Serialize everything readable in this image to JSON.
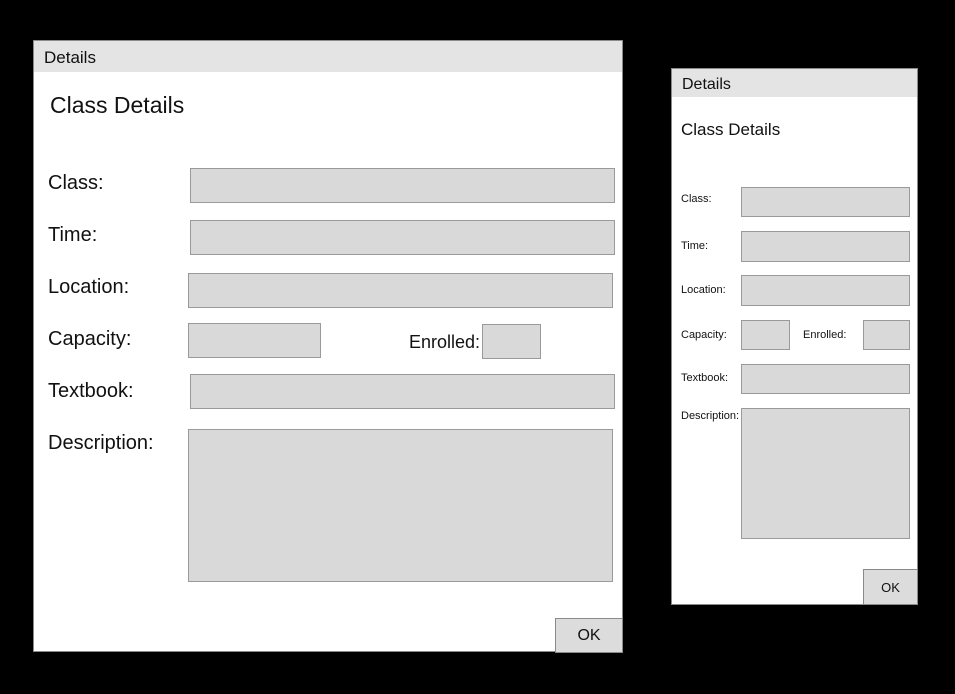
{
  "large_window": {
    "title": "Details",
    "heading": "Class Details",
    "labels": {
      "class": "Class:",
      "time": "Time:",
      "location": "Location:",
      "capacity": "Capacity:",
      "enrolled": "Enrolled:",
      "textbook": "Textbook:",
      "description": "Description:"
    },
    "ok_label": "OK"
  },
  "small_window": {
    "title": "Details",
    "heading": "Class Details",
    "labels": {
      "class": "Class:",
      "time": "Time:",
      "location": "Location:",
      "capacity": "Capacity:",
      "enrolled": "Enrolled:",
      "textbook": "Textbook:",
      "description": "Description:"
    },
    "ok_label": "OK"
  }
}
